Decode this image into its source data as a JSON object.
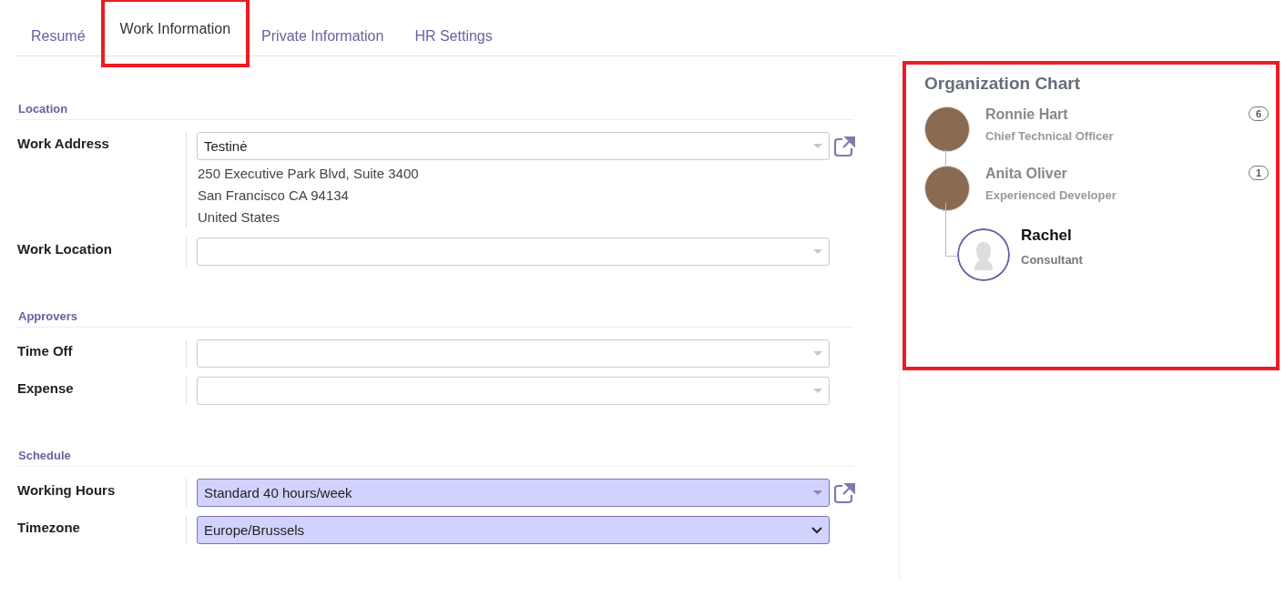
{
  "tabs": [
    {
      "label": "Resumé",
      "selected": false,
      "highlighted": false
    },
    {
      "label": "Work Information",
      "selected": true,
      "highlighted": true
    },
    {
      "label": "Private Information",
      "selected": false,
      "highlighted": false
    },
    {
      "label": "HR Settings",
      "selected": false,
      "highlighted": false
    }
  ],
  "sections": [
    {
      "title": "Location",
      "fields": [
        {
          "label": "Work Address",
          "kind": "many2one",
          "value": "Testinė",
          "required": false,
          "external_link": true,
          "address_lines": [
            "250 Executive Park Blvd, Suite 3400",
            "San Francisco CA 94134",
            "United States"
          ]
        },
        {
          "label": "Work Location",
          "kind": "many2one",
          "required": false,
          "external_link": false
        }
      ]
    },
    {
      "title": "Approvers",
      "fields": [
        {
          "label": "Time Off",
          "kind": "many2one",
          "required": false,
          "external_link": false
        },
        {
          "label": "Expense",
          "kind": "many2one",
          "required": false,
          "external_link": false
        }
      ]
    },
    {
      "title": "Schedule",
      "fields": [
        {
          "label": "Working Hours",
          "kind": "many2one",
          "value": "Standard 40 hours/week",
          "required": true,
          "external_link": true
        },
        {
          "label": "Timezone",
          "kind": "select",
          "value": "Europe/Brussels",
          "required": true,
          "external_link": false
        }
      ]
    }
  ],
  "org_chart": {
    "title": "Organization Chart",
    "highlighted": true,
    "people": [
      {
        "name": "Ronnie Hart",
        "job": "Chief Technical Officer",
        "count": "6",
        "selected": false,
        "photo": true,
        "children": [
          {
            "name": "Anita Oliver",
            "job": "Experienced Developer",
            "count": "1",
            "selected": false,
            "photo": true,
            "children": [
              {
                "name": "Rachel",
                "job": "Consultant",
                "selected": true,
                "photo": false
              }
            ]
          }
        ]
      }
    ]
  }
}
